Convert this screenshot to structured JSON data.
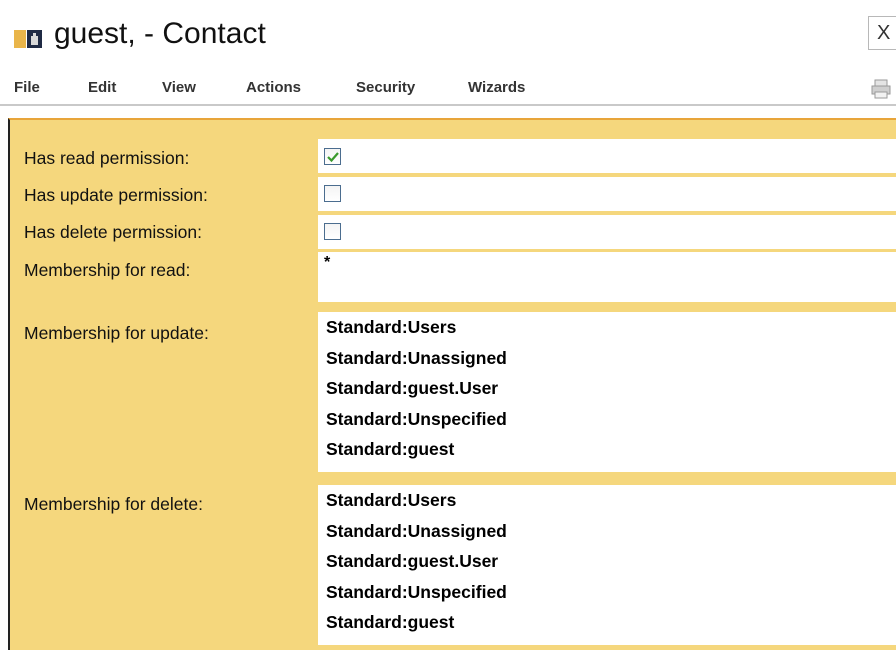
{
  "window": {
    "title": "guest, - Contact",
    "icon": "contact-card-icon",
    "close_label": "X"
  },
  "menu": {
    "items": [
      {
        "label": "File"
      },
      {
        "label": "Edit"
      },
      {
        "label": "View"
      },
      {
        "label": "Actions"
      },
      {
        "label": "Security"
      },
      {
        "label": "Wizards"
      }
    ],
    "print_icon": "printer-icon"
  },
  "form": {
    "read_permission": {
      "label": "Has read permission:",
      "checked": true
    },
    "update_permission": {
      "label": "Has update permission:",
      "checked": false
    },
    "delete_permission": {
      "label": "Has delete permission:",
      "checked": false
    },
    "membership_read": {
      "label": "Membership for read:",
      "value": "*"
    },
    "membership_update": {
      "label": "Membership for update:",
      "values": [
        "Standard:Users",
        "Standard:Unassigned",
        "Standard:guest.User",
        "Standard:Unspecified",
        "Standard:guest"
      ]
    },
    "membership_delete": {
      "label": "Membership for delete:",
      "values": [
        "Standard:Users",
        "Standard:Unassigned",
        "Standard:guest.User",
        "Standard:Unspecified",
        "Standard:guest"
      ]
    }
  },
  "colors": {
    "panel_background": "#f5d77d",
    "checkmark": "#3a9a2c"
  }
}
